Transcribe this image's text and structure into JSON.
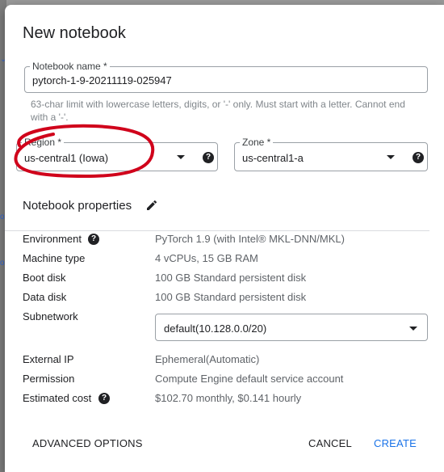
{
  "dialog": {
    "title": "New notebook"
  },
  "notebook_name": {
    "label": "Notebook name *",
    "value": "pytorch-1-9-20211119-025947",
    "hint": "63-char limit with lowercase letters, digits, or '-' only. Must start with a letter. Cannot end with a '-'."
  },
  "region": {
    "label": "Region *",
    "value": "us-central1 (Iowa)"
  },
  "zone": {
    "label": "Zone *",
    "value": "us-central1-a"
  },
  "properties": {
    "title": "Notebook properties",
    "environment": {
      "label": "Environment",
      "value": "PyTorch 1.9 (with Intel® MKL-DNN/MKL)"
    },
    "machine_type": {
      "label": "Machine type",
      "value": "4 vCPUs, 15 GB RAM"
    },
    "boot_disk": {
      "label": "Boot disk",
      "value": "100 GB Standard persistent disk"
    },
    "data_disk": {
      "label": "Data disk",
      "value": "100 GB Standard persistent disk"
    },
    "subnetwork": {
      "label": "Subnetwork",
      "value": "default(10.128.0.0/20)"
    },
    "external_ip": {
      "label": "External IP",
      "value": "Ephemeral(Automatic)"
    },
    "permission": {
      "label": "Permission",
      "value": "Compute Engine default service account"
    },
    "estimated_cost": {
      "label": "Estimated cost",
      "value": "$102.70 monthly, $0.141 hourly"
    }
  },
  "actions": {
    "advanced": "ADVANCED OPTIONS",
    "cancel": "CANCEL",
    "create": "CREATE"
  },
  "icons": {
    "help": "?",
    "edit": "pencil-icon",
    "dropdown": "caret-down-icon"
  },
  "colors": {
    "accent": "#1a73e8",
    "annotation": "#d0021b"
  }
}
